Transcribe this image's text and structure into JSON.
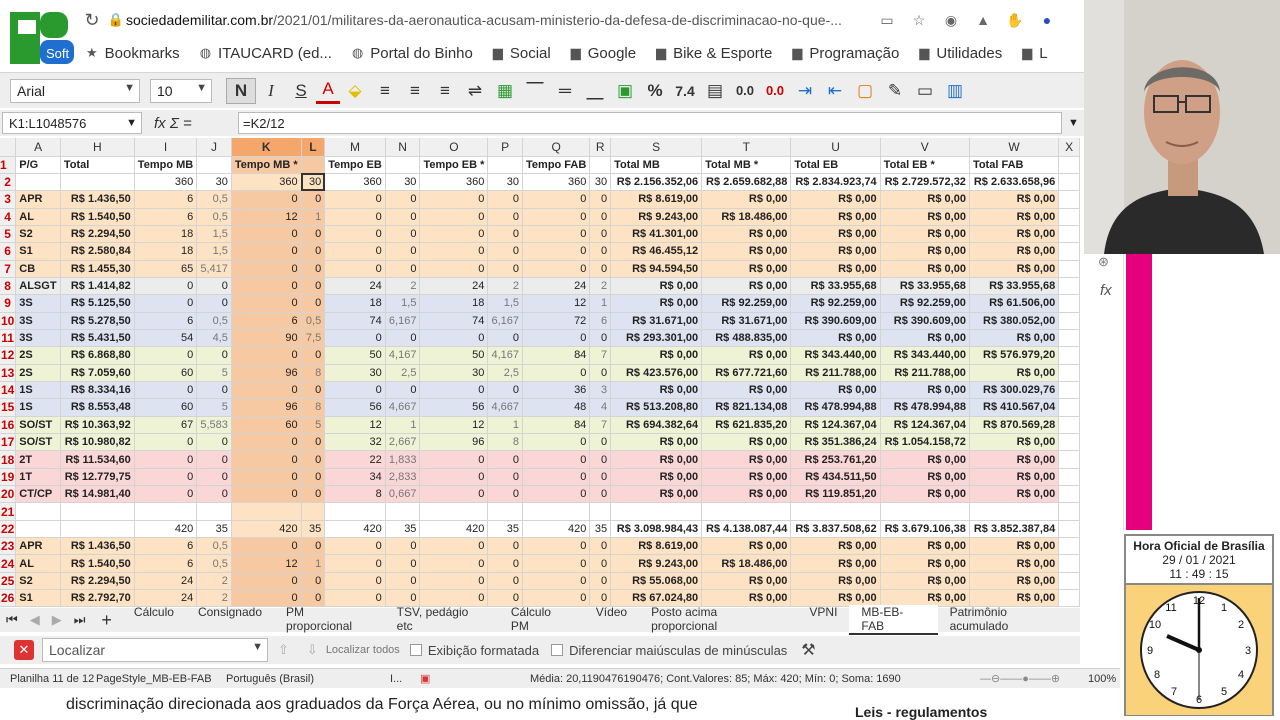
{
  "browser": {
    "url_domain": "sociedademilitar.com.br",
    "url_path": "/2021/01/militares-da-aeronautica-acusam-ministerio-da-defesa-de-discriminacao-no-que-...",
    "bookmarks": [
      {
        "label": "Bookmarks",
        "icon": "star-icon"
      },
      {
        "label": "ITAUCARD (ed...",
        "icon": "globe-icon"
      },
      {
        "label": "Portal do Binho",
        "icon": "globe-icon"
      },
      {
        "label": "Social",
        "icon": "folder-icon"
      },
      {
        "label": "Google",
        "icon": "folder-icon"
      },
      {
        "label": "Bike & Esporte",
        "icon": "folder-icon"
      },
      {
        "label": "Programação",
        "icon": "folder-icon"
      },
      {
        "label": "Utilidades",
        "icon": "folder-icon"
      },
      {
        "label": "L",
        "icon": "folder-icon"
      }
    ]
  },
  "toolbar": {
    "font_name": "Arial",
    "font_size": "10",
    "percent": "%",
    "number_fmt": "7.4",
    "dec_add": "0.0",
    "dec_remove": "0.0"
  },
  "formula_bar": {
    "name_box": "K1:L1048576",
    "fx": "fx Σ =",
    "formula": "=K2/12"
  },
  "grid": {
    "columns": [
      "A",
      "H",
      "I",
      "J",
      "K",
      "L",
      "M",
      "N",
      "O",
      "P",
      "Q",
      "R",
      "S",
      "T",
      "U",
      "V",
      "W",
      "X"
    ],
    "header": [
      "P/G",
      "Total",
      "Tempo MB",
      "",
      "Tempo MB *",
      "",
      "Tempo EB",
      "",
      "Tempo EB *",
      "",
      "Tempo FAB",
      "",
      "Total MB",
      "Total MB *",
      "Total EB",
      "Total EB *",
      "Total FAB",
      ""
    ],
    "rows": [
      {
        "n": "2",
        "c": [
          "",
          "",
          "360",
          "30",
          "360",
          "30",
          "360",
          "30",
          "360",
          "30",
          "360",
          "30",
          "R$ 2.156.352,06",
          "R$ 2.659.682,88",
          "R$ 2.834.923,74",
          "R$ 2.729.572,32",
          "R$ 2.633.658,96",
          ""
        ]
      },
      {
        "n": "3",
        "c": [
          "APR",
          "R$ 1.436,50",
          "6",
          "0,5",
          "0",
          "0",
          "0",
          "0",
          "0",
          "0",
          "0",
          "0",
          "R$ 8.619,00",
          "R$ 0,00",
          "R$ 0,00",
          "R$ 0,00",
          "R$ 0,00",
          ""
        ]
      },
      {
        "n": "4",
        "c": [
          "AL",
          "R$ 1.540,50",
          "6",
          "0,5",
          "12",
          "1",
          "0",
          "0",
          "0",
          "0",
          "0",
          "0",
          "R$ 9.243,00",
          "R$ 18.486,00",
          "R$ 0,00",
          "R$ 0,00",
          "R$ 0,00",
          ""
        ]
      },
      {
        "n": "5",
        "c": [
          "S2",
          "R$ 2.294,50",
          "18",
          "1,5",
          "0",
          "0",
          "0",
          "0",
          "0",
          "0",
          "0",
          "0",
          "R$ 41.301,00",
          "R$ 0,00",
          "R$ 0,00",
          "R$ 0,00",
          "R$ 0,00",
          ""
        ]
      },
      {
        "n": "6",
        "c": [
          "S1",
          "R$ 2.580,84",
          "18",
          "1,5",
          "0",
          "0",
          "0",
          "0",
          "0",
          "0",
          "0",
          "0",
          "R$ 46.455,12",
          "R$ 0,00",
          "R$ 0,00",
          "R$ 0,00",
          "R$ 0,00",
          ""
        ]
      },
      {
        "n": "7",
        "c": [
          "CB",
          "R$ 1.455,30",
          "65",
          "5,417",
          "0",
          "0",
          "0",
          "0",
          "0",
          "0",
          "0",
          "0",
          "R$ 94.594,50",
          "R$ 0,00",
          "R$ 0,00",
          "R$ 0,00",
          "R$ 0,00",
          ""
        ]
      },
      {
        "n": "8",
        "c": [
          "ALSGT",
          "R$ 1.414,82",
          "0",
          "0",
          "0",
          "0",
          "24",
          "2",
          "24",
          "2",
          "24",
          "2",
          "R$ 0,00",
          "R$ 0,00",
          "R$ 33.955,68",
          "R$ 33.955,68",
          "R$ 33.955,68",
          ""
        ]
      },
      {
        "n": "9",
        "c": [
          "3S",
          "R$ 5.125,50",
          "0",
          "0",
          "0",
          "0",
          "18",
          "1,5",
          "18",
          "1,5",
          "12",
          "1",
          "R$ 0,00",
          "R$ 92.259,00",
          "R$ 92.259,00",
          "R$ 92.259,00",
          "R$ 61.506,00",
          ""
        ]
      },
      {
        "n": "10",
        "c": [
          "3S",
          "R$ 5.278,50",
          "6",
          "0,5",
          "6",
          "0,5",
          "74",
          "6,167",
          "74",
          "6,167",
          "72",
          "6",
          "R$ 31.671,00",
          "R$ 31.671,00",
          "R$ 390.609,00",
          "R$ 390.609,00",
          "R$ 380.052,00",
          ""
        ]
      },
      {
        "n": "11",
        "c": [
          "3S",
          "R$ 5.431,50",
          "54",
          "4,5",
          "90",
          "7,5",
          "0",
          "0",
          "0",
          "0",
          "0",
          "0",
          "R$ 293.301,00",
          "R$ 488.835,00",
          "R$ 0,00",
          "R$ 0,00",
          "R$ 0,00",
          ""
        ]
      },
      {
        "n": "12",
        "c": [
          "2S",
          "R$ 6.868,80",
          "0",
          "0",
          "0",
          "0",
          "50",
          "4,167",
          "50",
          "4,167",
          "84",
          "7",
          "R$ 0,00",
          "R$ 0,00",
          "R$ 343.440,00",
          "R$ 343.440,00",
          "R$ 576.979,20",
          ""
        ]
      },
      {
        "n": "13",
        "c": [
          "2S",
          "R$ 7.059,60",
          "60",
          "5",
          "96",
          "8",
          "30",
          "2,5",
          "30",
          "2,5",
          "0",
          "0",
          "R$ 423.576,00",
          "R$ 677.721,60",
          "R$ 211.788,00",
          "R$ 211.788,00",
          "R$ 0,00",
          ""
        ]
      },
      {
        "n": "14",
        "c": [
          "1S",
          "R$ 8.334,16",
          "0",
          "0",
          "0",
          "0",
          "0",
          "0",
          "0",
          "0",
          "36",
          "3",
          "R$ 0,00",
          "R$ 0,00",
          "R$ 0,00",
          "R$ 0,00",
          "R$ 300.029,76",
          ""
        ]
      },
      {
        "n": "15",
        "c": [
          "1S",
          "R$ 8.553,48",
          "60",
          "5",
          "96",
          "8",
          "56",
          "4,667",
          "56",
          "4,667",
          "48",
          "4",
          "R$ 513.208,80",
          "R$ 821.134,08",
          "R$ 478.994,88",
          "R$ 478.994,88",
          "R$ 410.567,04",
          ""
        ]
      },
      {
        "n": "16",
        "c": [
          "SO/ST",
          "R$ 10.363,92",
          "67",
          "5,583",
          "60",
          "5",
          "12",
          "1",
          "12",
          "1",
          "84",
          "7",
          "R$ 694.382,64",
          "R$ 621.835,20",
          "R$ 124.367,04",
          "R$ 124.367,04",
          "R$ 870.569,28",
          ""
        ]
      },
      {
        "n": "17",
        "c": [
          "SO/ST",
          "R$ 10.980,82",
          "0",
          "0",
          "0",
          "0",
          "32",
          "2,667",
          "96",
          "8",
          "0",
          "0",
          "R$ 0,00",
          "R$ 0,00",
          "R$ 351.386,24",
          "R$ 1.054.158,72",
          "R$ 0,00",
          ""
        ]
      },
      {
        "n": "18",
        "c": [
          "2T",
          "R$ 11.534,60",
          "0",
          "0",
          "0",
          "0",
          "22",
          "1,833",
          "0",
          "0",
          "0",
          "0",
          "R$ 0,00",
          "R$ 0,00",
          "R$ 253.761,20",
          "R$ 0,00",
          "R$ 0,00",
          ""
        ]
      },
      {
        "n": "19",
        "c": [
          "1T",
          "R$ 12.779,75",
          "0",
          "0",
          "0",
          "0",
          "34",
          "2,833",
          "0",
          "0",
          "0",
          "0",
          "R$ 0,00",
          "R$ 0,00",
          "R$ 434.511,50",
          "R$ 0,00",
          "R$ 0,00",
          ""
        ]
      },
      {
        "n": "20",
        "c": [
          "CT/CP",
          "R$ 14.981,40",
          "0",
          "0",
          "0",
          "0",
          "8",
          "0,667",
          "0",
          "0",
          "0",
          "0",
          "R$ 0,00",
          "R$ 0,00",
          "R$ 119.851,20",
          "R$ 0,00",
          "R$ 0,00",
          ""
        ]
      },
      {
        "n": "21",
        "c": [
          "",
          "",
          "",
          "",
          "",
          "",
          "",
          "",
          "",
          "",
          "",
          "",
          "",
          "",
          "",
          "",
          "",
          ""
        ]
      },
      {
        "n": "22",
        "c": [
          "",
          "",
          "420",
          "35",
          "420",
          "35",
          "420",
          "35",
          "420",
          "35",
          "420",
          "35",
          "R$ 3.098.984,43",
          "R$ 4.138.087,44",
          "R$ 3.837.508,62",
          "R$ 3.679.106,38",
          "R$ 3.852.387,84",
          ""
        ]
      },
      {
        "n": "23",
        "c": [
          "APR",
          "R$ 1.436,50",
          "6",
          "0,5",
          "0",
          "0",
          "0",
          "0",
          "0",
          "0",
          "0",
          "0",
          "R$ 8.619,00",
          "R$ 0,00",
          "R$ 0,00",
          "R$ 0,00",
          "R$ 0,00",
          ""
        ]
      },
      {
        "n": "24",
        "c": [
          "AL",
          "R$ 1.540,50",
          "6",
          "0,5",
          "12",
          "1",
          "0",
          "0",
          "0",
          "0",
          "0",
          "0",
          "R$ 9.243,00",
          "R$ 18.486,00",
          "R$ 0,00",
          "R$ 0,00",
          "R$ 0,00",
          ""
        ]
      },
      {
        "n": "25",
        "c": [
          "S2",
          "R$ 2.294,50",
          "24",
          "2",
          "0",
          "0",
          "0",
          "0",
          "0",
          "0",
          "0",
          "0",
          "R$ 55.068,00",
          "R$ 0,00",
          "R$ 0,00",
          "R$ 0,00",
          "R$ 0,00",
          ""
        ]
      },
      {
        "n": "26",
        "c": [
          "S1",
          "R$ 2.792,70",
          "24",
          "2",
          "0",
          "0",
          "0",
          "0",
          "0",
          "0",
          "0",
          "0",
          "R$ 67.024,80",
          "R$ 0,00",
          "R$ 0,00",
          "R$ 0,00",
          "R$ 0,00",
          ""
        ]
      }
    ],
    "row_colors": {
      "orange": "#fde3c4",
      "grey": "#ececec",
      "blue": "#dde3f0",
      "green": "#eef3d6",
      "pink": "#fbd6d6",
      "white": "#ffffff",
      "sel": "#f6c9a2"
    }
  },
  "sheet_tabs": [
    "Cálculo",
    "Consignado",
    "PM proporcional",
    "TSV, pedágio etc",
    "Cálculo PM",
    "Vídeo",
    "Posto acima proporcional",
    "VPNI",
    "MB-EB-FAB",
    "Patrimônio acumulado"
  ],
  "active_tab": "MB-EB-FAB",
  "find": {
    "placeholder": "Localizar",
    "find_all": "Localizar todos",
    "formatted": "Exibição formatada",
    "match_case": "Diferenciar maiúsculas de minúsculas"
  },
  "status": {
    "sheet": "Planilha 11 de 12",
    "style": "PageStyle_MB-EB-FAB",
    "lang": "Português (Brasil)",
    "insert": "I...",
    "stats": "Média: 20,1190476190476; Cont.Valores: 85; Máx: 420; Mín: 0; Soma: 1690",
    "zoom": "100%"
  },
  "caption": "discriminação direcionada aos graduados da Força Aérea, ou no mínimo omissão, já que",
  "side_caption": "Leis - regulamentos",
  "clock": {
    "title": "Hora Oficial de Brasília",
    "date": "29 / 01 / 2021",
    "time": "11 : 49 : 15"
  },
  "logo_letters": "RB Soft"
}
